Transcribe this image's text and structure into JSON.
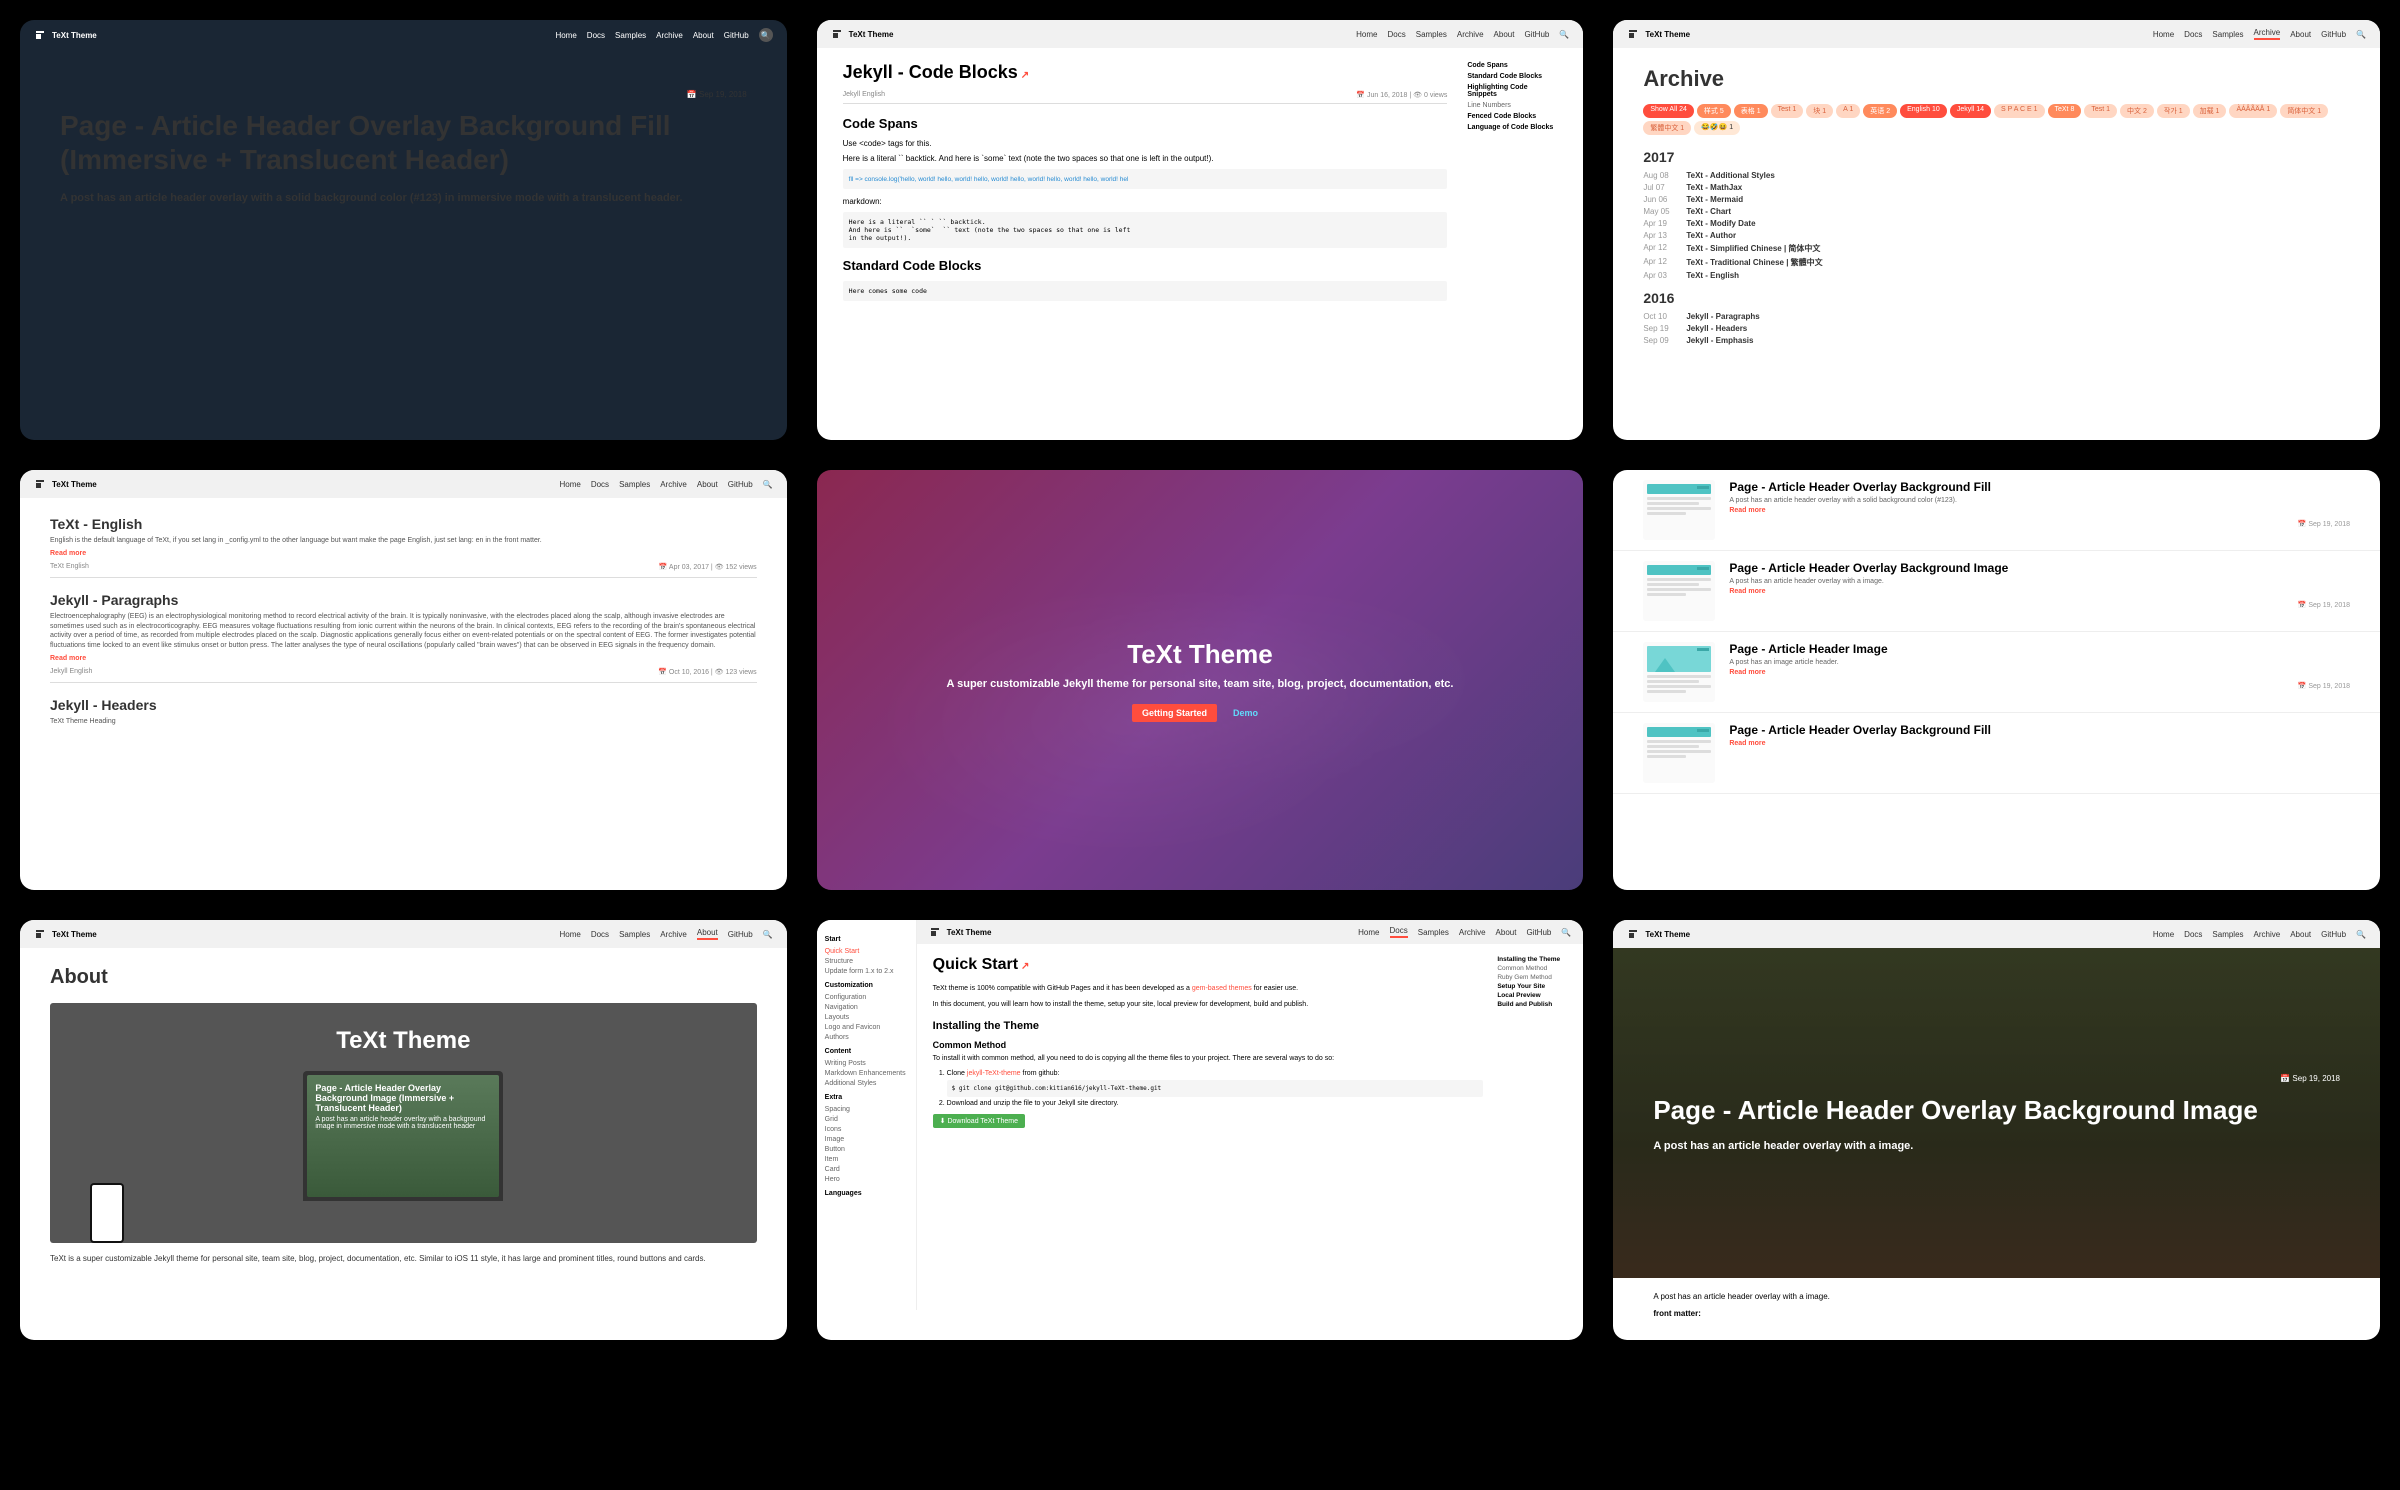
{
  "brand": "TeXt Theme",
  "nav": {
    "home": "Home",
    "docs": "Docs",
    "samples": "Samples",
    "archive": "Archive",
    "about": "About",
    "github": "GitHub"
  },
  "card1": {
    "date": "📅 Sep 19, 2018",
    "title": "Page - Article Header Overlay Background Fill (Immersive + Translucent Header)",
    "sub": "A post has an article header overlay with a solid background color (#123) in immersive mode with a translucent header."
  },
  "card2": {
    "title": "Jekyll - Code Blocks",
    "tags": "Jekyll    English",
    "date": "📅 Jun 16, 2018   |   👁 0 views",
    "h2a": "Code Spans",
    "p1": "Use <code> tags for this.",
    "p2": "Here is a literal `` backtick. And here is `some` text (note the two spaces so that one is left in the output!).",
    "pre1": "fll => console.log('hello, world! hello, world! hello, world! hello, world! hello, world! hello, world! hel",
    "md": "markdown:",
    "pre2": "Here is a literal `` ` `` backtick.\nAnd here is ``  `some`  `` text (note the two spaces so that one is left\nin the output!).",
    "h2b": "Standard Code Blocks",
    "pre3": "Here comes some code",
    "toc": [
      "Code Spans",
      "Standard Code Blocks",
      "Highlighting Code Snippets",
      "Line Numbers",
      "Fenced Code Blocks",
      "Language of Code Blocks"
    ]
  },
  "card3": {
    "title": "Archive",
    "pills": [
      {
        "t": "Show All 24",
        "c": "red"
      },
      {
        "t": "样式 5",
        "c": ""
      },
      {
        "t": "表格 1",
        "c": ""
      },
      {
        "t": "Test 1",
        "c": "lite"
      },
      {
        "t": "块 1",
        "c": "lite"
      },
      {
        "t": "A 1",
        "c": "lite"
      },
      {
        "t": "英语 2",
        "c": ""
      },
      {
        "t": "English 10",
        "c": "red"
      },
      {
        "t": "Jekyll 14",
        "c": "red"
      },
      {
        "t": "S P A C E 1",
        "c": "lite"
      },
      {
        "t": "TeXt 8",
        "c": ""
      },
      {
        "t": "Test 1",
        "c": "lite"
      },
      {
        "t": "中文 2",
        "c": "lite"
      },
      {
        "t": "작가 1",
        "c": "lite"
      },
      {
        "t": "加载 1",
        "c": "lite"
      },
      {
        "t": "ÀÁÂÃÄÅ 1",
        "c": "lite"
      },
      {
        "t": "简体中文 1",
        "c": "lite"
      },
      {
        "t": "繁體中文 1",
        "c": "lite"
      },
      {
        "t": "😂🤣😆 1",
        "c": "emoji"
      }
    ],
    "y2017": "2017",
    "rows2017": [
      {
        "d": "Aug 08",
        "t": "TeXt - Additional Styles"
      },
      {
        "d": "Jul 07",
        "t": "TeXt - MathJax"
      },
      {
        "d": "Jun 06",
        "t": "TeXt - Mermaid"
      },
      {
        "d": "May 05",
        "t": "TeXt - Chart"
      },
      {
        "d": "Apr 19",
        "t": "TeXt - Modify Date"
      },
      {
        "d": "Apr 13",
        "t": "TeXt - Author"
      },
      {
        "d": "Apr 12",
        "t": "TeXt - Simplified Chinese | 简体中文"
      },
      {
        "d": "Apr 12",
        "t": "TeXt - Traditional Chinese | 繁體中文"
      },
      {
        "d": "Apr 03",
        "t": "TeXt - English"
      }
    ],
    "y2016": "2016",
    "rows2016": [
      {
        "d": "Oct 10",
        "t": "Jekyll - Paragraphs"
      },
      {
        "d": "Sep 19",
        "t": "Jekyll - Headers"
      },
      {
        "d": "Sep 09",
        "t": "Jekyll - Emphasis"
      }
    ]
  },
  "card4": {
    "a1": {
      "title": "TeXt - English",
      "sub": "English is the default language of TeXt, if you set lang in _config.yml to the other language but want make the page English, just set lang: en in the front matter.",
      "rm": "Read more",
      "tags": "TeXt    English",
      "date": "📅 Apr 03, 2017   |   👁 152 views"
    },
    "a2": {
      "title": "Jekyll - Paragraphs",
      "sub": "Electroencephalography (EEG) is an electrophysiological monitoring method to record electrical activity of the brain. It is typically noninvasive, with the electrodes placed along the scalp, although invasive electrodes are sometimes used such as in electrocorticography. EEG measures voltage fluctuations resulting from ionic current within the neurons of the brain. In clinical contexts, EEG refers to the recording of the brain's spontaneous electrical activity over a period of time, as recorded from multiple electrodes placed on the scalp. Diagnostic applications generally focus either on event-related potentials or on the spectral content of EEG. The former investigates potential fluctuations time locked to an event like stimulus onset or button press. The latter analyses the type of neural oscillations (popularly called \"brain waves\") that can be observed in EEG signals in the frequency domain.",
      "rm": "Read more",
      "tags": "Jekyll    English",
      "date": "📅 Oct 10, 2016   |   👁 123 views"
    },
    "a3": {
      "title": "Jekyll - Headers",
      "sub": "TeXt Theme Heading"
    }
  },
  "card5": {
    "title": "TeXt Theme",
    "sub": "A super customizable Jekyll theme for personal site, team site, blog, project, documentation, etc.",
    "btn1": "Getting Started",
    "btn2": "Demo"
  },
  "card6": {
    "items": [
      {
        "title": "Page - Article Header Overlay Background Fill",
        "sub": "A post has an article header overlay with a solid background color (#123).",
        "date": "📅 Sep 19, 2018",
        "thumb": "plain"
      },
      {
        "title": "Page - Article Header Overlay Background Image",
        "sub": "A post has an article header overlay with a image.",
        "date": "📅 Sep 19, 2018",
        "thumb": "plain"
      },
      {
        "title": "Page - Article Header Image",
        "sub": "A post has an image article header.",
        "date": "📅 Sep 19, 2018",
        "thumb": "img"
      },
      {
        "title": "Page - Article Header Overlay Background Fill",
        "sub": "",
        "date": "",
        "thumb": "plain"
      }
    ],
    "rm": "Read more"
  },
  "card7": {
    "title": "About",
    "promo": "TeXt Theme",
    "screen_title": "Page - Article Header Overlay Background Image (Immersive + Translucent Header)",
    "screen_sub": "A post has an article header overlay with a background image in immersive mode with a translucent header",
    "desc": "TeXt is a super customizable Jekyll theme for personal site, team site, blog, project, documentation, etc. Similar to iOS 11 style, it has large and prominent titles, round buttons and cards."
  },
  "card8": {
    "sidebar": {
      "sec1": "Start",
      "items1": [
        "Quick Start",
        "Structure",
        "Update form 1.x to 2.x"
      ],
      "sec2": "Customization",
      "items2": [
        "Configuration",
        "Navigation",
        "Layouts",
        "Logo and Favicon",
        "Authors"
      ],
      "sec3": "Content",
      "items3": [
        "Writing Posts",
        "Markdown Enhancements",
        "Additional Styles"
      ],
      "sec4": "Extra",
      "items4": [
        "Spacing",
        "Grid",
        "Icons",
        "Image",
        "Button",
        "Item",
        "Card",
        "Hero"
      ],
      "sec5": "Languages"
    },
    "doc": {
      "title": "Quick Start",
      "p1a": "TeXt theme is 100% compatible with GitHub Pages and it has been developed as a ",
      "p1link": "gem-based themes",
      "p1b": " for easier use.",
      "p2": "In this document, you will learn how to install the theme, setup your site, local preview for development, build and publish.",
      "h2a": "Installing the Theme",
      "h3a": "Common Method",
      "p3": "To install it with common method, all you need to do is copying all the theme files to your project. There are several ways to do so:",
      "li1a": "Clone ",
      "li1link": "jekyll-TeXt-theme",
      "li1b": " from github:",
      "code1": "$ git clone git@github.com:kitian616/jekyll-TeXt-theme.git",
      "li2": "Download and unzip the file to your Jekyll site directory.",
      "dlbtn": "⬇ Download TeXt Theme"
    },
    "toc": [
      "Installing the Theme",
      "Common Method",
      "Ruby Gem Method",
      "Setup Your Site",
      "Local Preview",
      "Build and Publish"
    ]
  },
  "card9": {
    "date": "📅 Sep 19, 2018",
    "title": "Page - Article Header Overlay Background Image",
    "sub": "A post has an article header overlay with a image.",
    "below1": "A post has an article header overlay with a image.",
    "below2": "front matter:"
  }
}
